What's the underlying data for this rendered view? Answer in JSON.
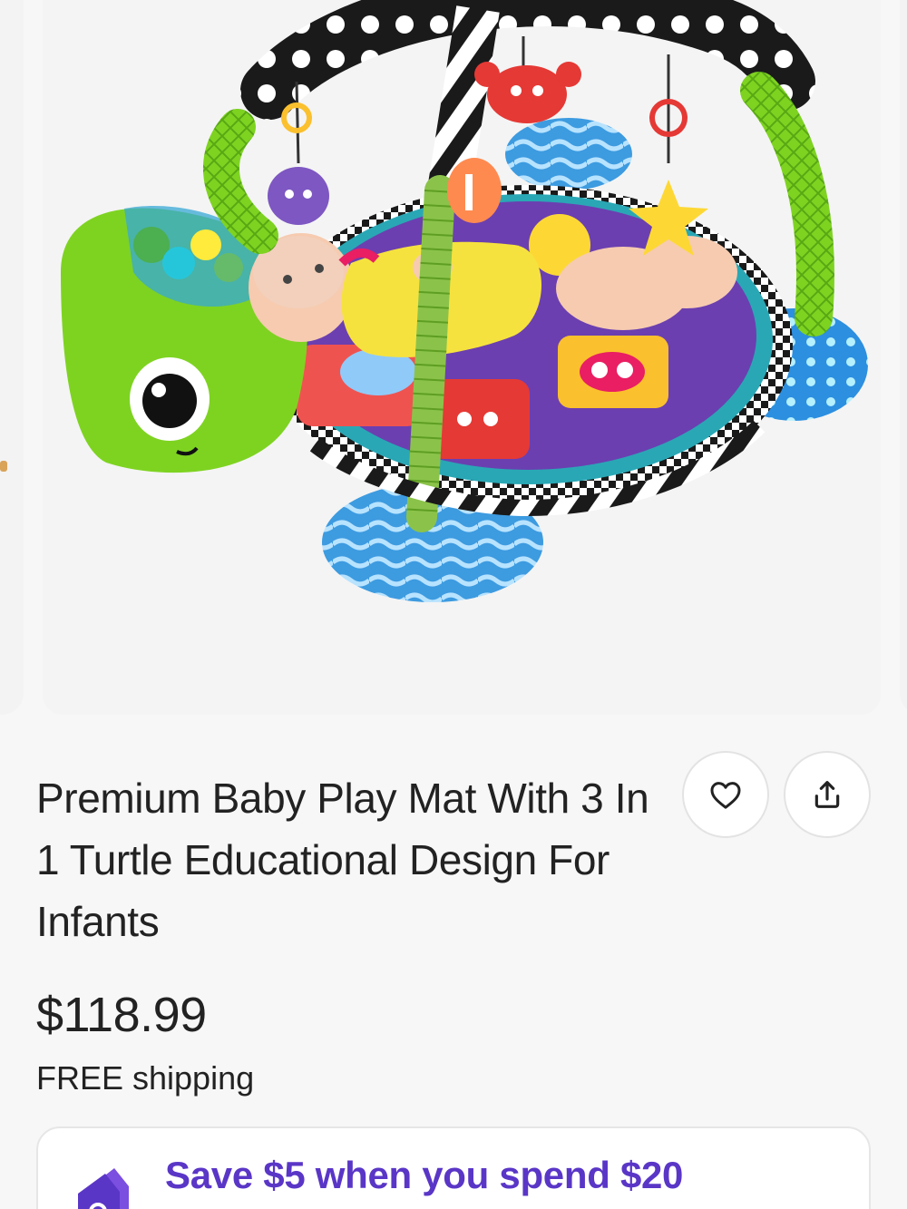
{
  "listing": {
    "title": "Premium Baby Play Mat With 3 In 1 Turtle Educational Design For Infants",
    "price": "$118.99",
    "shipping": "FREE shipping"
  },
  "actions": {
    "favorite_icon": "heart-icon",
    "share_icon": "share-icon"
  },
  "promo": {
    "text": "Save $5 when you spend $20",
    "icon": "price-tag-icon",
    "color": "#5a36c7"
  }
}
